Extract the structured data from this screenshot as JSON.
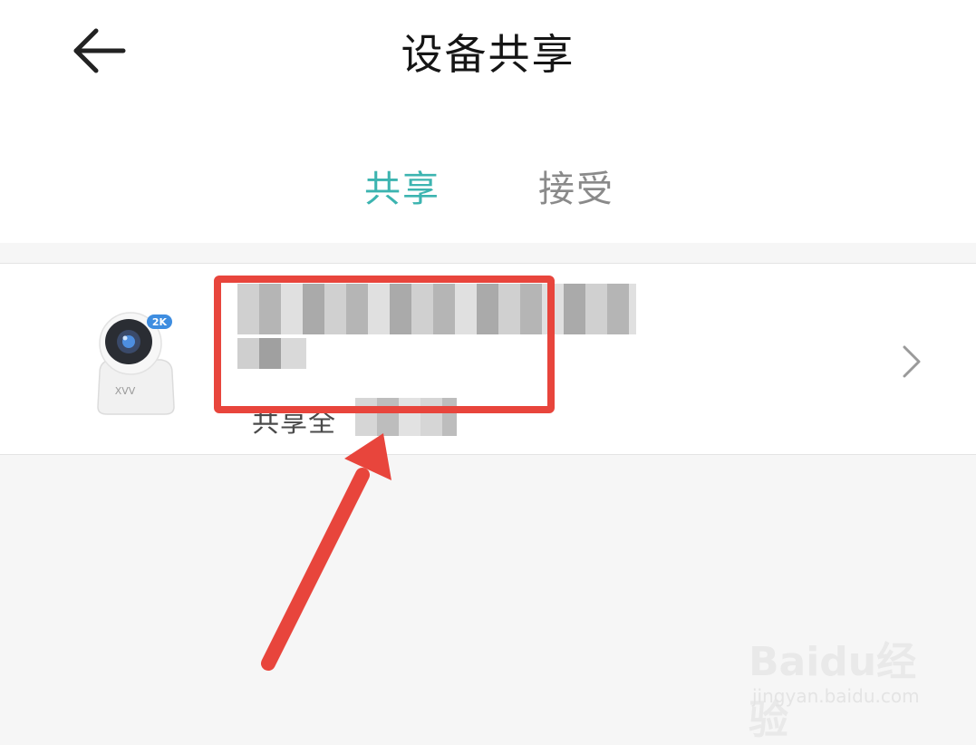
{
  "header": {
    "title": "设备共享",
    "back_icon": "arrow-left-icon"
  },
  "tabs": [
    {
      "label": "共享",
      "active": true,
      "color": "#3cb4b0"
    },
    {
      "label": "接受",
      "active": false,
      "color": "#8a8a8a"
    }
  ],
  "device": {
    "badge": "2K",
    "brand": "XVV",
    "status_prefix": "共享全",
    "chevron_icon": "chevron-right-icon"
  },
  "annotation": {
    "box_color": "#e8453c",
    "arrow_color": "#e8453c"
  },
  "watermark": {
    "logo": "Baidu经验",
    "url": "jingyan.baidu.com"
  }
}
